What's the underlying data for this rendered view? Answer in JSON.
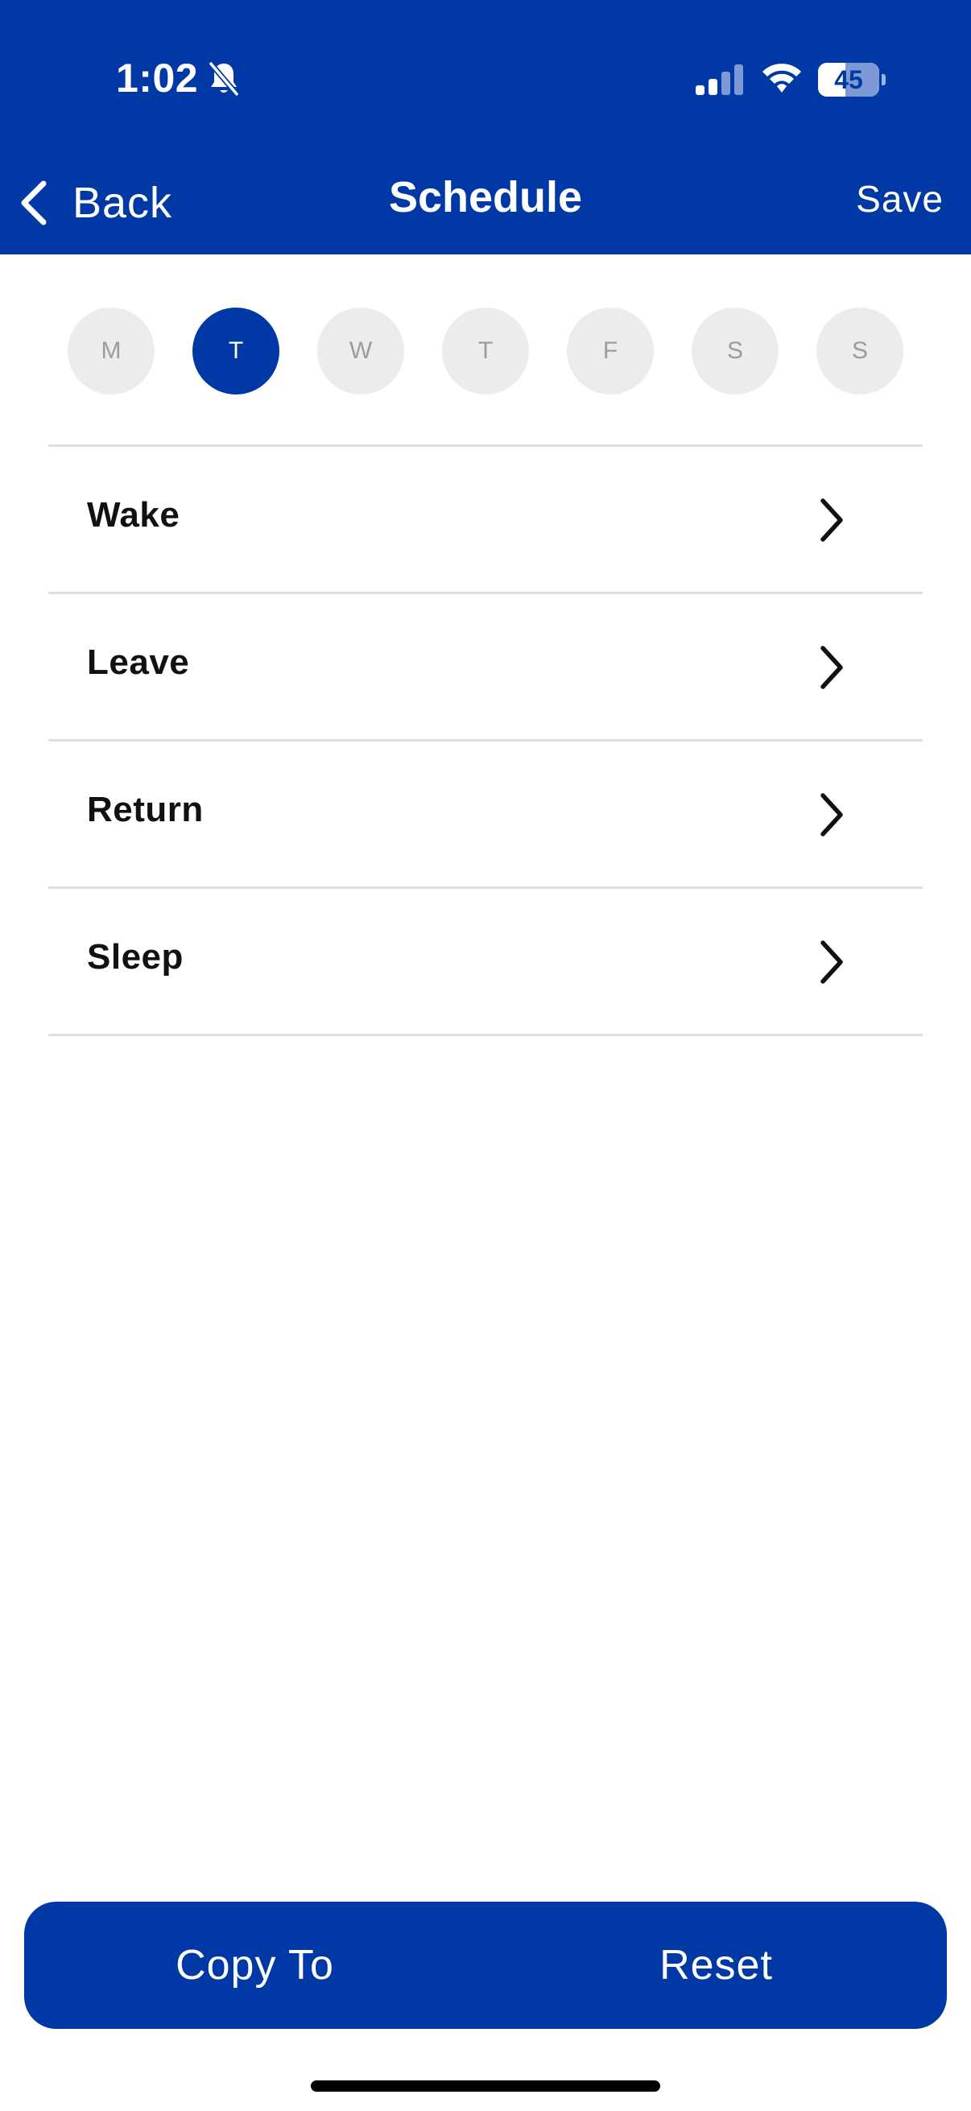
{
  "status_bar": {
    "time": "1:02",
    "battery_percent": "45",
    "battery_level": 0.45,
    "icons": [
      "bell-slash-icon",
      "cellular-signal-icon",
      "wifi-icon",
      "battery-icon"
    ]
  },
  "nav": {
    "back_label": "Back",
    "title": "Schedule",
    "save_label": "Save"
  },
  "days": [
    {
      "label": "M",
      "selected": false
    },
    {
      "label": "T",
      "selected": true
    },
    {
      "label": "W",
      "selected": false
    },
    {
      "label": "T",
      "selected": false
    },
    {
      "label": "F",
      "selected": false
    },
    {
      "label": "S",
      "selected": false
    },
    {
      "label": "S",
      "selected": false
    }
  ],
  "periods": [
    {
      "label": "Wake"
    },
    {
      "label": "Leave"
    },
    {
      "label": "Return"
    },
    {
      "label": "Sleep"
    }
  ],
  "actions": {
    "copy_to_label": "Copy To",
    "reset_label": "Reset"
  },
  "colors": {
    "brand_blue": "#0039a6",
    "day_inactive_bg": "#ececec",
    "day_inactive_text": "#9c9c9c",
    "divider": "#dedede"
  }
}
